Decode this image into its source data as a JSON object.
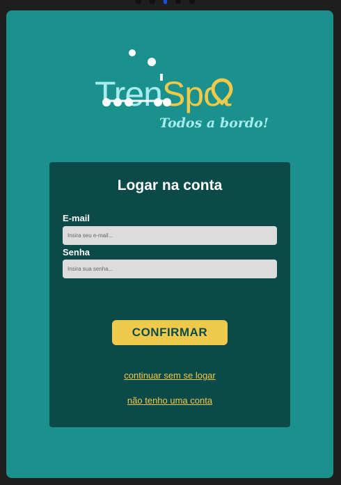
{
  "brand": {
    "name_part1": "Tren",
    "name_part2": "Spot",
    "slogan": "Todos a bordo!"
  },
  "login": {
    "title": "Logar na conta",
    "email_label": "E-mail",
    "email_placeholder": "Insira seu e-mail...",
    "email_value": "",
    "password_label": "Senha",
    "password_placeholder": "Insira sua senha...",
    "password_value": "",
    "confirm_label": "CONFIRMAR",
    "guest_link": "continuar sem se logar",
    "signup_link": "não tenho uma conta"
  },
  "colors": {
    "background": "#1a918c",
    "card": "#0b4a48",
    "accent": "#efc94c",
    "logo_light": "#a5ecee"
  },
  "icons": {
    "logo_mark": "train-icon",
    "logo_pin": "location-pin-icon"
  }
}
